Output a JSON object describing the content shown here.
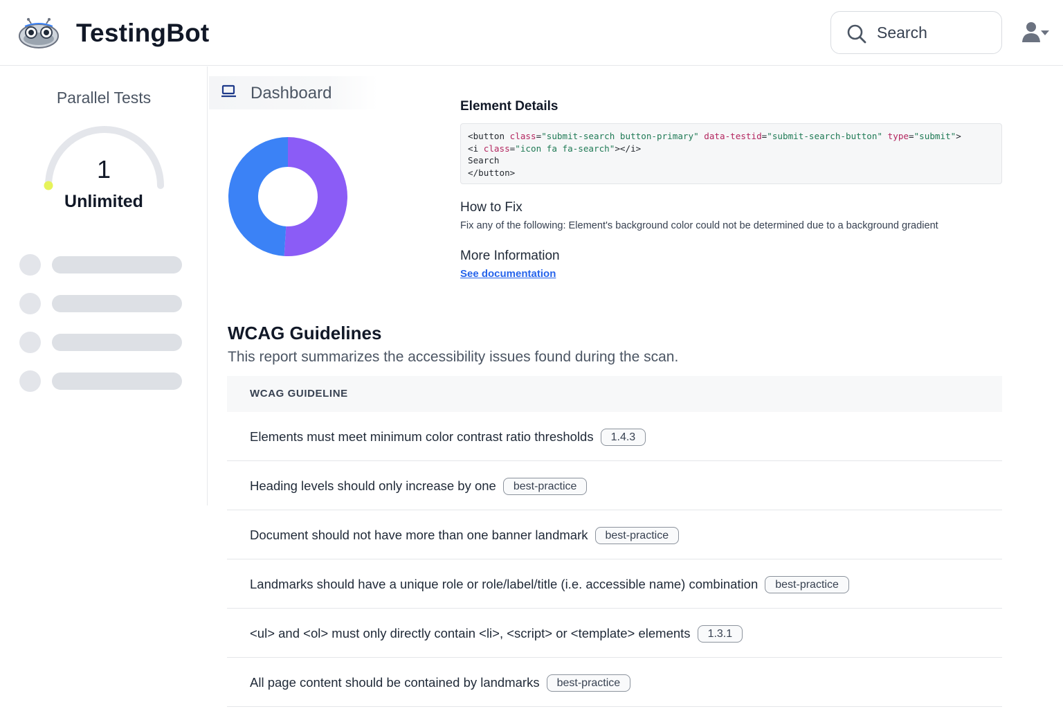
{
  "header": {
    "brand": "TestingBot",
    "search_label": "Search",
    "logo_icon": "robot-logo-icon",
    "user_icon": "user-menu-icon"
  },
  "sidebar": {
    "title": "Parallel Tests",
    "gauge_value": "1",
    "gauge_label": "Unlimited",
    "gauge_level": 0,
    "gauge_color": "#e6f35a"
  },
  "dashboard": {
    "tab_label": "Dashboard",
    "donut": {
      "segments": [
        {
          "value": 51,
          "color": "#8b5cf6"
        },
        {
          "value": 49,
          "color": "#3b82f6"
        }
      ]
    }
  },
  "details": {
    "title": "Element Details",
    "code_lines": [
      "<button class=\"submit-search button-primary\" data-testid=\"submit-search-button\" type=\"submit\">",
      "<i class=\"icon fa fa-search\"></i>",
      "Search",
      "</button>"
    ],
    "fix_title": "How to Fix",
    "fix_text": "Fix any of the following: Element's background color could not be determined due to a background gradient",
    "more_title": "More Information",
    "doc_link": "See documentation"
  },
  "wcag": {
    "title": "WCAG Guidelines",
    "subtitle": "This report summarizes the accessibility issues found during the scan.",
    "column_header": "WCAG GUIDELINE",
    "rows": [
      {
        "text": "Elements must meet minimum color contrast ratio thresholds",
        "badge": "1.4.3"
      },
      {
        "text": "Heading levels should only increase by one",
        "badge": "best-practice"
      },
      {
        "text": "Document should not have more than one banner landmark",
        "badge": "best-practice"
      },
      {
        "text": "Landmarks should have a unique role or role/label/title (i.e. accessible name) combination",
        "badge": "best-practice"
      },
      {
        "text": "<ul> and <ol> must only directly contain <li>, <script> or <template> elements",
        "badge": "1.3.1"
      },
      {
        "text": "All page content should be contained by landmarks",
        "badge": "best-practice"
      }
    ]
  }
}
